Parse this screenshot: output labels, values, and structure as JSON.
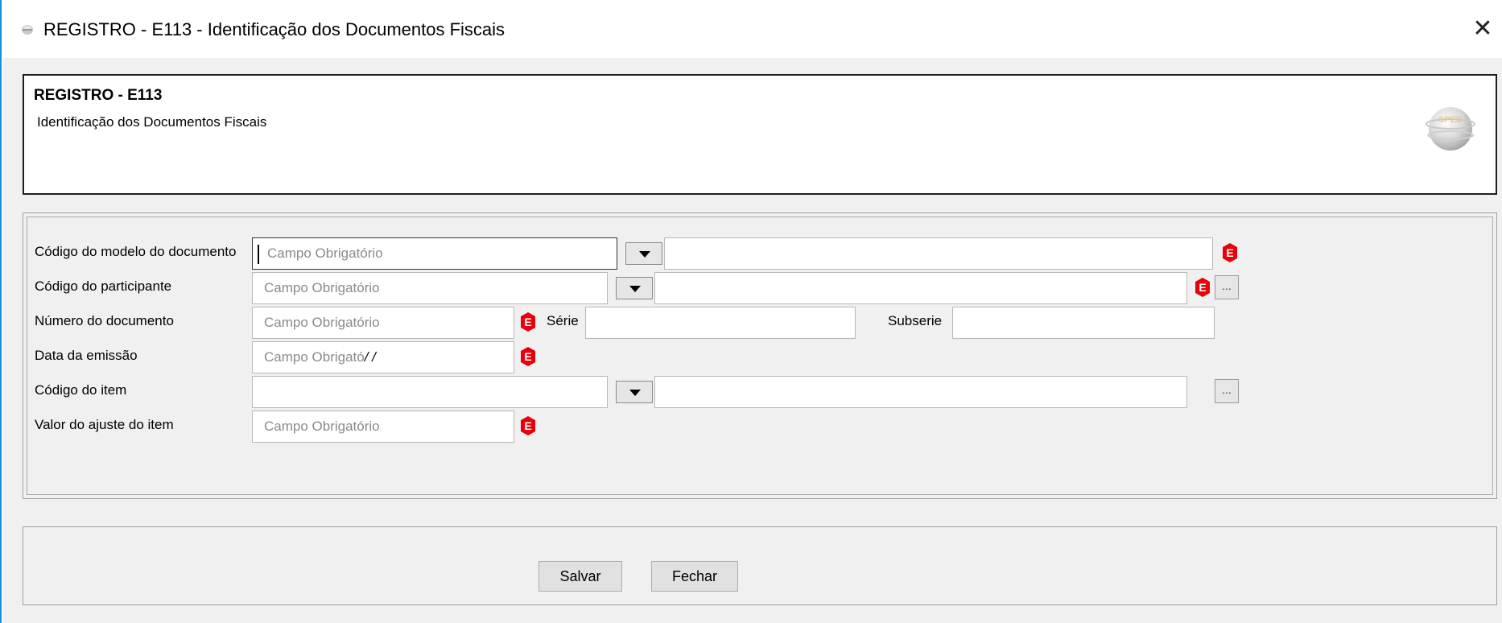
{
  "window": {
    "title": "REGISTRO - E113 - Identificação dos Documentos Fiscais",
    "close_label": "✕"
  },
  "header": {
    "title": "REGISTRO - E113",
    "subtitle": "Identificação dos Documentos Fiscais",
    "logo_text": "SPED"
  },
  "form": {
    "modelo": {
      "label": "Código do modelo do documento",
      "placeholder": "Campo Obrigatório",
      "description": ""
    },
    "participante": {
      "label": "Código do participante",
      "placeholder": "Campo Obrigatório",
      "description": "",
      "browse_label": "..."
    },
    "numero": {
      "label": "Número do documento",
      "placeholder": "Campo Obrigatório"
    },
    "serie": {
      "label": "Série",
      "value": ""
    },
    "subserie": {
      "label": "Subserie",
      "value": ""
    },
    "data": {
      "label": "Data da emissão",
      "placeholder": "Campo Obrigató",
      "mask": "/ /"
    },
    "item": {
      "label": "Código do item",
      "value": "",
      "description": "",
      "browse_label": "..."
    },
    "valor": {
      "label": "Valor do ajuste do item",
      "placeholder": "Campo Obrigatório"
    },
    "error_badge": "E"
  },
  "buttons": {
    "save_label": "Salvar",
    "close_label": "Fechar"
  },
  "colors": {
    "error_red": "#e8000b",
    "window_border": "#1a8fe0",
    "client_bg": "#f0f0f0"
  }
}
